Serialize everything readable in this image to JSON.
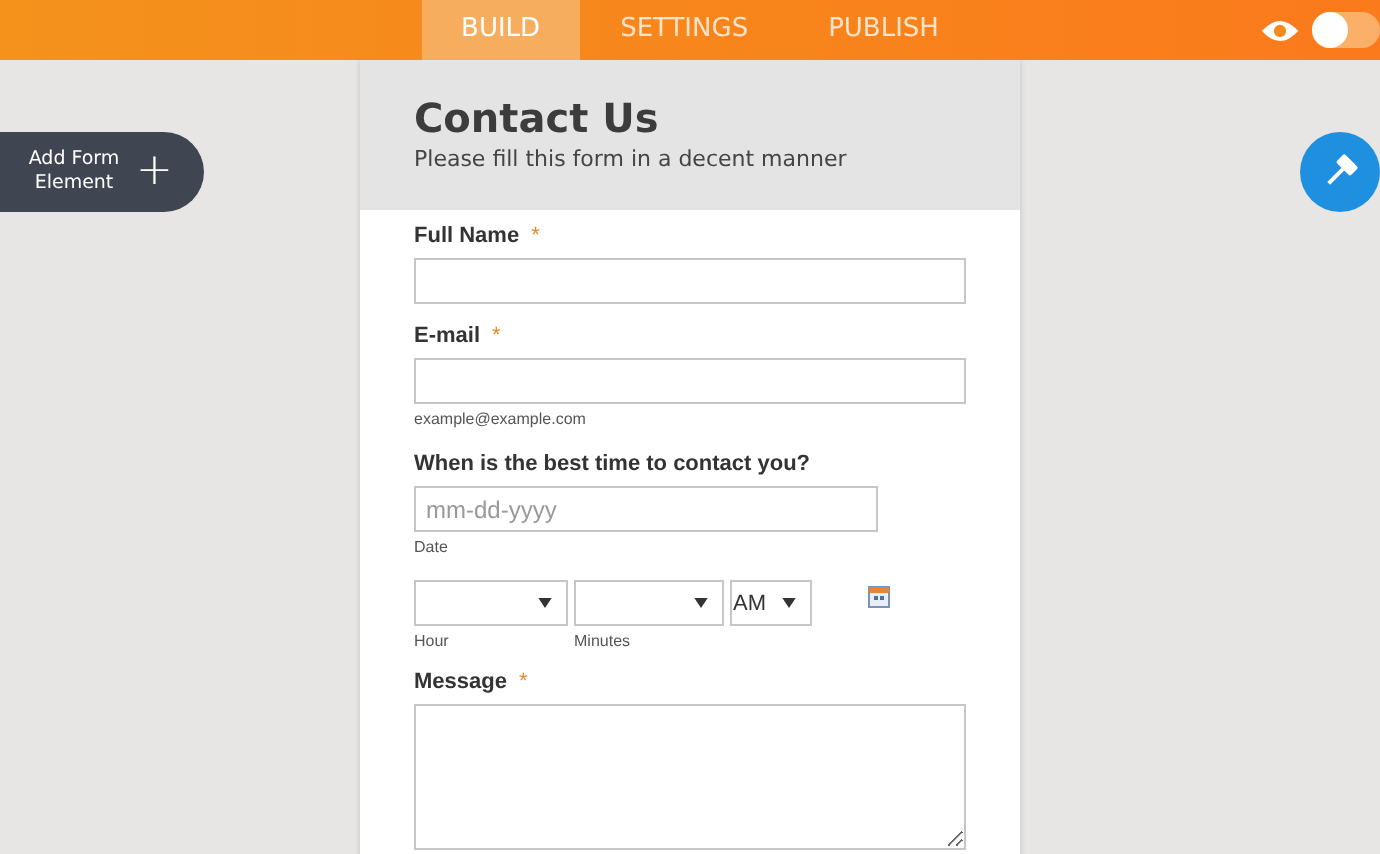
{
  "tabs": [
    {
      "label": "BUILD",
      "selected": true
    },
    {
      "label": "SETTINGS",
      "selected": false
    },
    {
      "label": "PUBLISH",
      "selected": false
    }
  ],
  "preview_toggle": {
    "on": false
  },
  "add_button": {
    "label": "Add Form Element",
    "plus": "+"
  },
  "form": {
    "title": "Contact Us",
    "subtitle": "Please fill this form in a decent manner",
    "fields": [
      {
        "kind": "text",
        "label": "Full Name",
        "marker": "*"
      },
      {
        "kind": "text",
        "label": "E-mail",
        "marker": "*",
        "hint": "example@example.com"
      },
      {
        "kind": "date",
        "label": "When is the best time to contact you?",
        "placeholder": "mm-dd-yyyy",
        "hint": "Date"
      },
      {
        "kind": "time",
        "parts": [
          {
            "hint": "Hour"
          },
          {
            "hint": "Minutes"
          },
          {
            "value": "AM"
          }
        ]
      },
      {
        "kind": "textarea",
        "label": "Message",
        "marker": "*"
      }
    ]
  }
}
